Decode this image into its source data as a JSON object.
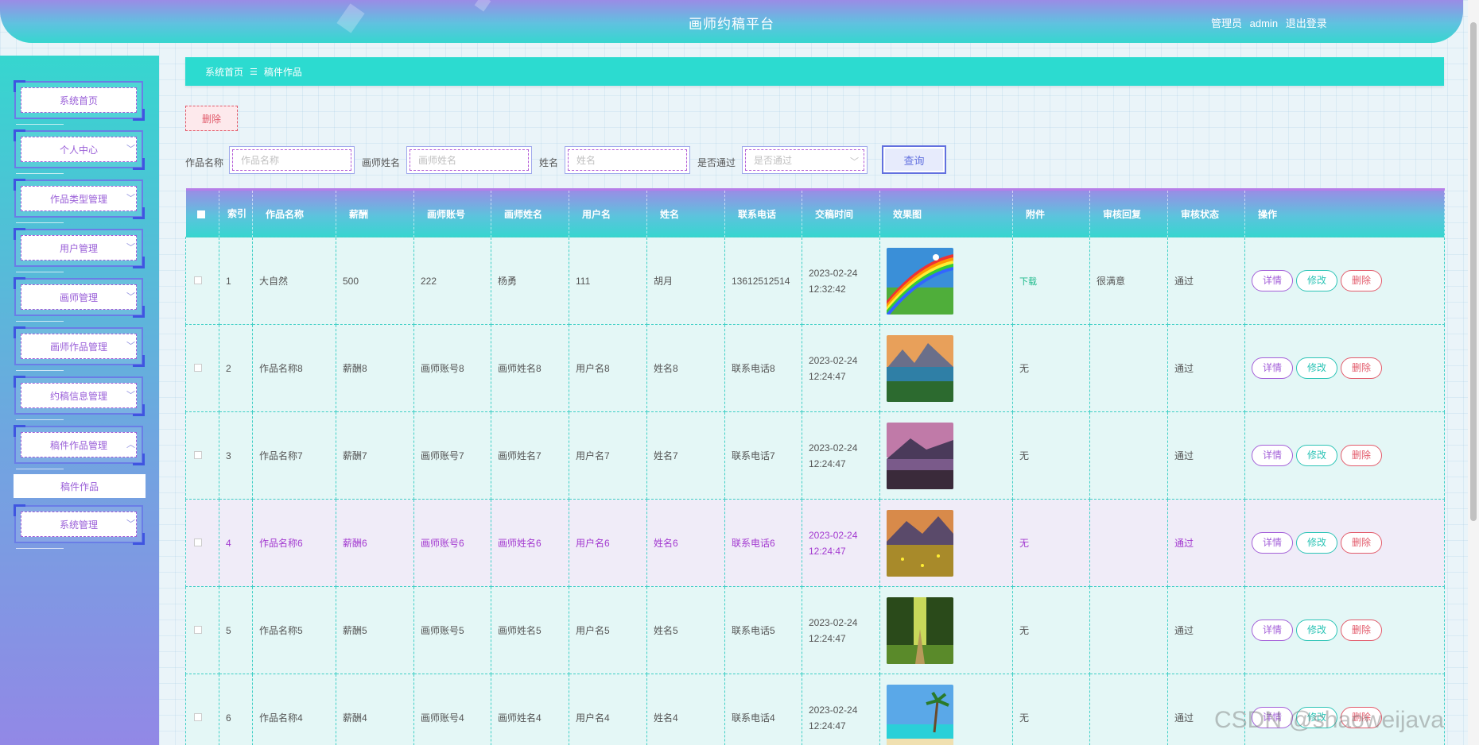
{
  "header": {
    "title": "画师约稿平台",
    "role": "管理员",
    "username": "admin",
    "logout": "退出登录"
  },
  "sidebar": {
    "items": [
      {
        "label": "系统首页",
        "has_arrow": false
      },
      {
        "label": "个人中心",
        "has_arrow": true
      },
      {
        "label": "作品类型管理",
        "has_arrow": true
      },
      {
        "label": "用户管理",
        "has_arrow": true
      },
      {
        "label": "画师管理",
        "has_arrow": true
      },
      {
        "label": "画师作品管理",
        "has_arrow": true
      },
      {
        "label": "约稿信息管理",
        "has_arrow": true
      },
      {
        "label": "稿件作品管理",
        "has_arrow": true,
        "expanded": true
      },
      {
        "label": "系统管理",
        "has_arrow": true
      }
    ],
    "submenu_label": "稿件作品"
  },
  "breadcrumb": {
    "home": "系统首页",
    "sep": "☰",
    "current": "稿件作品"
  },
  "toolbar": {
    "delete_label": "删除"
  },
  "search": {
    "work_name_label": "作品名称",
    "work_name_placeholder": "作品名称",
    "artist_name_label": "画师姓名",
    "artist_name_placeholder": "画师姓名",
    "name_label": "姓名",
    "name_placeholder": "姓名",
    "approved_label": "是否通过",
    "approved_placeholder": "是否通过",
    "query_label": "查询"
  },
  "table": {
    "headers": [
      "索引",
      "作品名称",
      "薪酬",
      "画师账号",
      "画师姓名",
      "用户名",
      "姓名",
      "联系电话",
      "交稿时间",
      "效果图",
      "附件",
      "审核回复",
      "审核状态",
      "操作"
    ],
    "rows": [
      {
        "idx": "1",
        "name": "大自然",
        "pay": "500",
        "acct": "222",
        "artist": "杨勇",
        "user": "111",
        "realname": "胡月",
        "phone": "13612512514",
        "time": "2023-02-24 12:32:42",
        "image": "rainbow",
        "attach": "下载",
        "reply": "很满意",
        "status": "通过"
      },
      {
        "idx": "2",
        "name": "作品名称8",
        "pay": "薪酬8",
        "acct": "画师账号8",
        "artist": "画师姓名8",
        "user": "用户名8",
        "realname": "姓名8",
        "phone": "联系电话8",
        "time": "2023-02-24 12:24:47",
        "image": "lake",
        "attach": "无",
        "reply": "",
        "status": "通过"
      },
      {
        "idx": "3",
        "name": "作品名称7",
        "pay": "薪酬7",
        "acct": "画师账号7",
        "artist": "画师姓名7",
        "user": "用户名7",
        "realname": "姓名7",
        "phone": "联系电话7",
        "time": "2023-02-24 12:24:47",
        "image": "sunset",
        "attach": "无",
        "reply": "",
        "status": "通过"
      },
      {
        "idx": "4",
        "name": "作品名称6",
        "pay": "薪酬6",
        "acct": "画师账号6",
        "artist": "画师姓名6",
        "user": "用户名6",
        "realname": "姓名6",
        "phone": "联系电话6",
        "time": "2023-02-24 12:24:47",
        "image": "meadow",
        "attach": "无",
        "reply": "",
        "status": "通过"
      },
      {
        "idx": "5",
        "name": "作品名称5",
        "pay": "薪酬5",
        "acct": "画师账号5",
        "artist": "画师姓名5",
        "user": "用户名5",
        "realname": "姓名5",
        "phone": "联系电话5",
        "time": "2023-02-24 12:24:47",
        "image": "forest",
        "attach": "无",
        "reply": "",
        "status": "通过"
      },
      {
        "idx": "6",
        "name": "作品名称4",
        "pay": "薪酬4",
        "acct": "画师账号4",
        "artist": "画师姓名4",
        "user": "用户名4",
        "realname": "姓名4",
        "phone": "联系电话4",
        "time": "2023-02-24 12:24:47",
        "image": "beach",
        "attach": "无",
        "reply": "",
        "status": "通过"
      }
    ],
    "actions": {
      "detail": "详情",
      "edit": "修改",
      "delete": "删除"
    }
  },
  "watermark": "CSDN @shaoweijava"
}
